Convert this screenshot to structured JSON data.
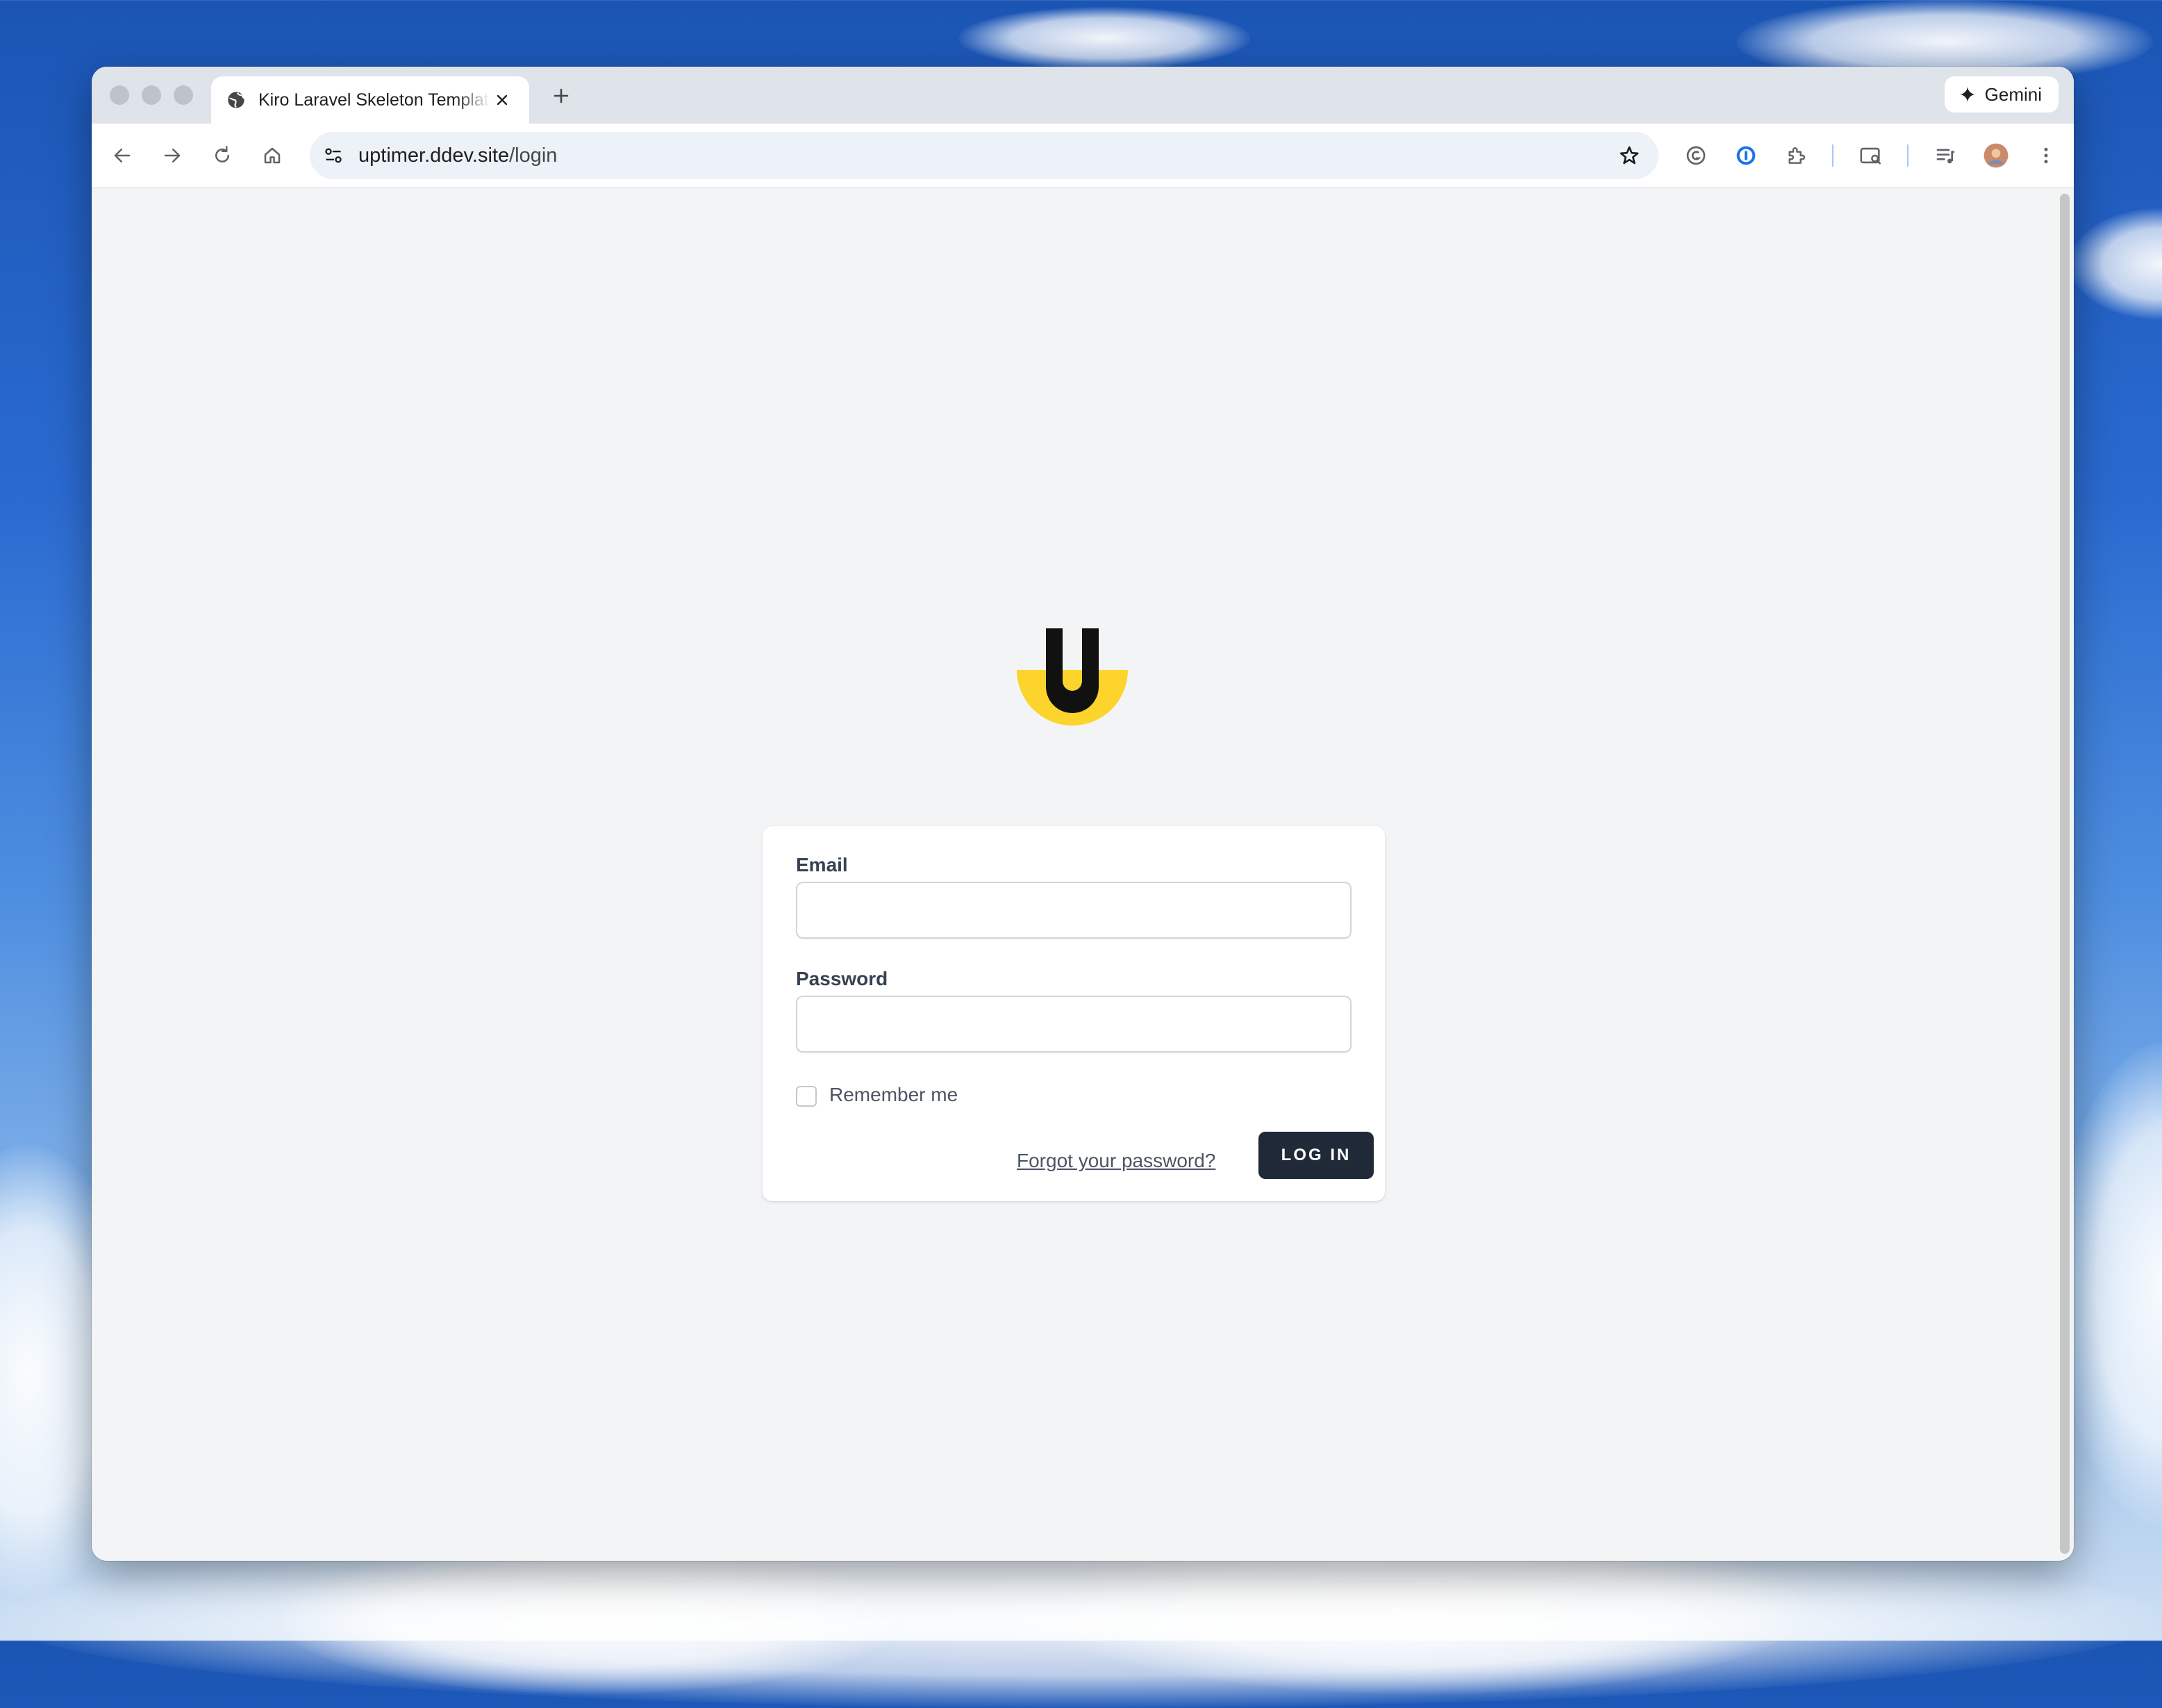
{
  "browser": {
    "tab_title": "Kiro Laravel Skeleton Template",
    "url_host": "uptimer.ddev.site",
    "url_path": "/login",
    "gemini_label": "Gemini",
    "icons": {
      "back": "arrow-left-icon",
      "forward": "arrow-right-icon",
      "reload": "reload-icon",
      "home": "home-icon",
      "site_info": "tune-icon",
      "bookmark": "star-icon",
      "extensions": [
        "grammarly-icon",
        "password-manager-icon",
        "puzzle-icon",
        "search-tab-icon",
        "media-queue-icon",
        "avatar",
        "kebab-menu-icon"
      ]
    }
  },
  "login": {
    "logo_letter": "U",
    "email_label": "Email",
    "email_value": "",
    "password_label": "Password",
    "password_value": "",
    "remember_label": "Remember me",
    "remember_checked": false,
    "forgot_link": "Forgot your password?",
    "submit_label": "LOG IN"
  },
  "colors": {
    "logo_yellow": "#fdd42b",
    "button_dark": "#1f2937",
    "page_bg": "#f3f4f6"
  }
}
